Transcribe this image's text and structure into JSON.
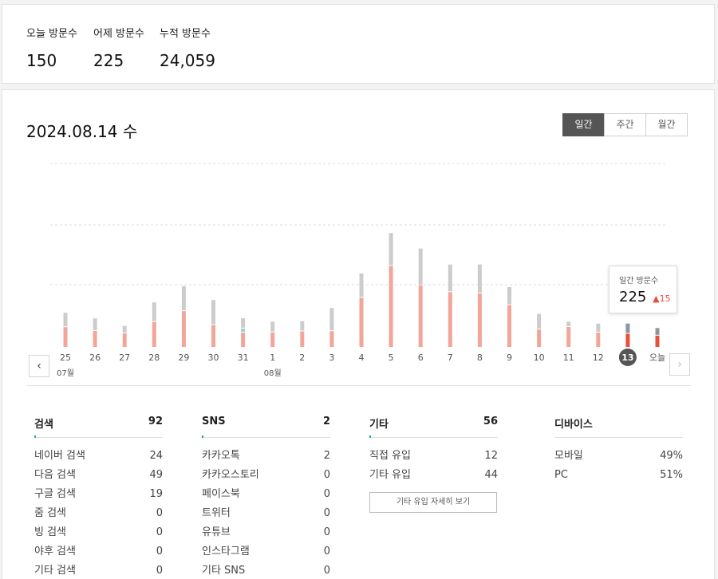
{
  "summary": {
    "today_label": "오늘 방문수",
    "today_value": "150",
    "yesterday_label": "어제 방문수",
    "yesterday_value": "225",
    "total_label": "누적 방문수",
    "total_value": "24,059"
  },
  "date_title": "2024.08.14 수",
  "period_tabs": [
    "일간",
    "주간",
    "월간"
  ],
  "colors": {
    "bar_primary": "#f2a599",
    "bar_secondary": "#cccccc",
    "bar_tertiary": "#9cd3cc",
    "bar_selected_primary": "#e8503a",
    "bar_selected_secondary": "#8c96a0",
    "delta_up": "#e8503a",
    "accent": "#1aa7a7"
  },
  "chart_data": {
    "type": "bar",
    "stacked": true,
    "categories": [
      "25",
      "26",
      "27",
      "28",
      "29",
      "30",
      "31",
      "1",
      "2",
      "3",
      "4",
      "5",
      "6",
      "7",
      "8",
      "9",
      "10",
      "11",
      "12",
      "13",
      "오늘"
    ],
    "month_labels": [
      {
        "at": "25",
        "label": "07월"
      },
      {
        "at": "1",
        "label": "08월"
      }
    ],
    "series": [
      {
        "values": [
          84,
          68,
          58,
          106,
          152,
          93,
          60,
          62,
          66,
          67,
          209,
          345,
          262,
          233,
          228,
          178,
          74,
          85,
          61,
          56,
          48
        ]
      },
      {
        "values": [
          58,
          50,
          28,
          80,
          103,
          103,
          40,
          42,
          40,
          95,
          100,
          136,
          153,
          114,
          119,
          73,
          63,
          19,
          35,
          40,
          29
        ]
      },
      {
        "values": [
          0,
          0,
          0,
          0,
          0,
          0,
          15,
          0,
          0,
          0,
          0,
          0,
          0,
          0,
          0,
          0,
          0,
          0,
          0,
          0,
          0
        ]
      }
    ],
    "ylim": [
      0,
      780
    ],
    "grid": true,
    "selected": "13",
    "tooltip": {
      "label": "일간 방문수",
      "value": "225",
      "delta": "15",
      "direction": "up"
    }
  },
  "nav": {
    "prev_glyph": "‹",
    "next_glyph": "›"
  },
  "categories": [
    {
      "title": "검색",
      "total": "92",
      "rows": [
        [
          "네이버 검색",
          "24"
        ],
        [
          "다음 검색",
          "49"
        ],
        [
          "구글 검색",
          "19"
        ],
        [
          "줌 검색",
          "0"
        ],
        [
          "빙 검색",
          "0"
        ],
        [
          "야후 검색",
          "0"
        ],
        [
          "기타 검색",
          "0"
        ]
      ]
    },
    {
      "title": "SNS",
      "total": "2",
      "rows": [
        [
          "카카오톡",
          "2"
        ],
        [
          "카카오스토리",
          "0"
        ],
        [
          "페이스북",
          "0"
        ],
        [
          "트위터",
          "0"
        ],
        [
          "유튜브",
          "0"
        ],
        [
          "인스타그램",
          "0"
        ],
        [
          "기타 SNS",
          "0"
        ]
      ]
    },
    {
      "title": "기타",
      "total": "56",
      "rows": [
        [
          "직접 유입",
          "12"
        ],
        [
          "기타 유입",
          "44"
        ]
      ],
      "detail_button": "기타 유입 자세히 보기"
    },
    {
      "title": "디바이스",
      "total": "",
      "rows": [
        [
          "모바일",
          "49%"
        ],
        [
          "PC",
          "51%"
        ]
      ]
    }
  ]
}
